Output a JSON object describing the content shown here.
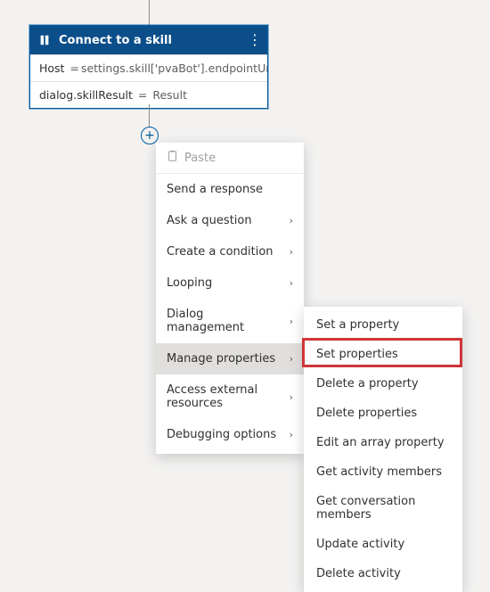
{
  "colors": {
    "header_bg": "#0b4e8a",
    "accent": "#005a9e",
    "highlight": "#d13438"
  },
  "card": {
    "title": "Connect to a skill",
    "row1_label": "Host",
    "row1_eq": "=",
    "row1_value": "settings.skill['pvaBot'].endpointUrl",
    "row2_label": "dialog.skillResult",
    "row2_eq": "=",
    "row2_value": "Result"
  },
  "plus_label": "+",
  "context_menu": {
    "paste": "Paste",
    "items": [
      {
        "label": "Send a response",
        "hasSub": false,
        "selected": false
      },
      {
        "label": "Ask a question",
        "hasSub": true,
        "selected": false
      },
      {
        "label": "Create a condition",
        "hasSub": true,
        "selected": false
      },
      {
        "label": "Looping",
        "hasSub": true,
        "selected": false
      },
      {
        "label": "Dialog management",
        "hasSub": true,
        "selected": false
      },
      {
        "label": "Manage properties",
        "hasSub": true,
        "selected": true
      },
      {
        "label": "Access external resources",
        "hasSub": true,
        "selected": false
      },
      {
        "label": "Debugging options",
        "hasSub": true,
        "selected": false
      }
    ]
  },
  "submenu": {
    "items": [
      {
        "label": "Set a property"
      },
      {
        "label": "Set properties"
      },
      {
        "label": "Delete a property"
      },
      {
        "label": "Delete properties"
      },
      {
        "label": "Edit an array property"
      },
      {
        "label": "Get activity members"
      },
      {
        "label": "Get conversation members"
      },
      {
        "label": "Update activity"
      },
      {
        "label": "Delete activity"
      }
    ]
  }
}
